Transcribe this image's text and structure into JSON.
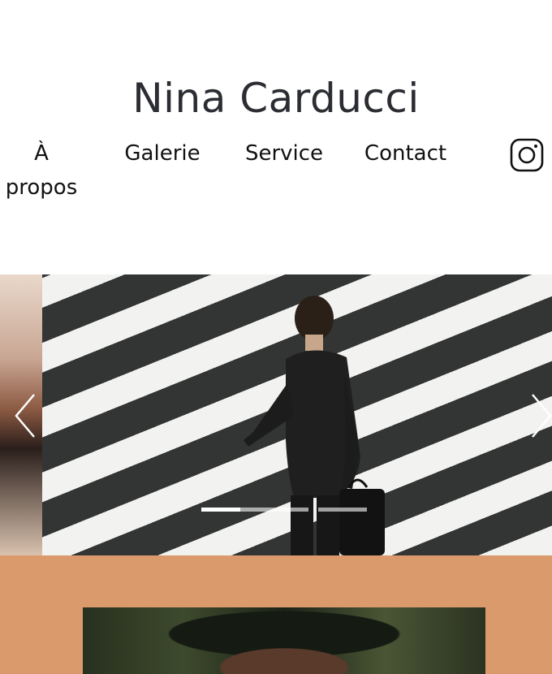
{
  "site": {
    "title": "Nina Carducci"
  },
  "nav": {
    "items": [
      {
        "label": "À propos"
      },
      {
        "label": "Galerie"
      },
      {
        "label": "Service"
      },
      {
        "label": "Contact"
      }
    ],
    "instagram_icon": "instagram-icon"
  },
  "carousel": {
    "slides_count": 3,
    "active_slide": 1,
    "prev_icon": "chevron-left-icon",
    "next_icon": "chevron-right-icon"
  },
  "colors": {
    "title": "#2b2d33",
    "about_band": "#db9a6c"
  }
}
